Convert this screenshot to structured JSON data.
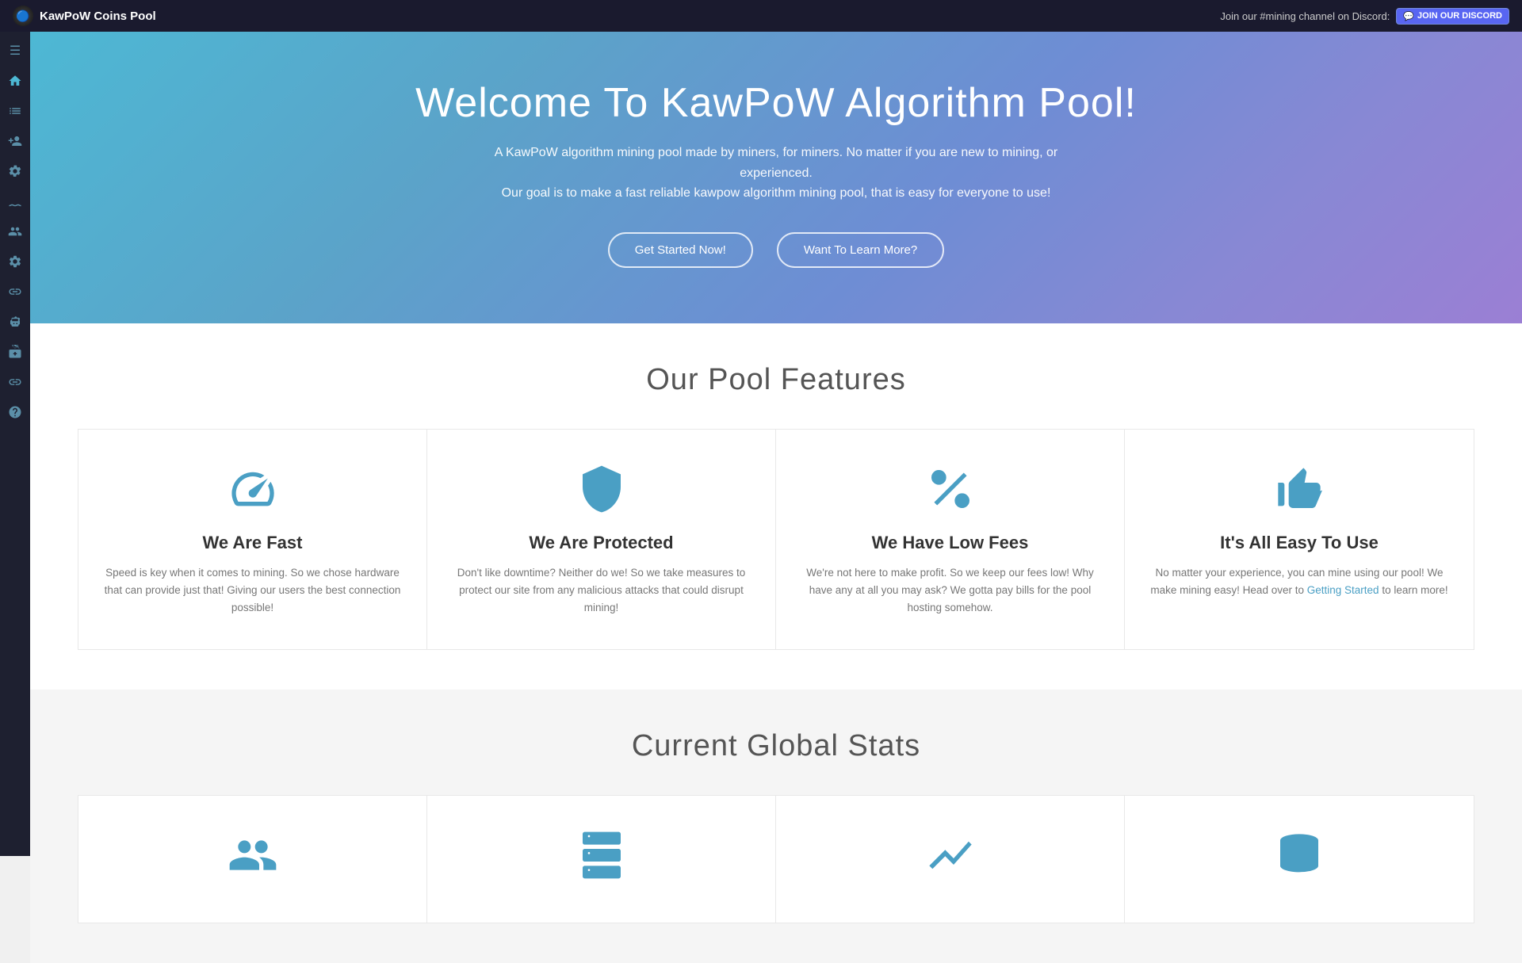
{
  "topbar": {
    "logo_icon": "🔵",
    "site_title": "KawPoW Coins Pool",
    "discord_text": "Join our #mining channel on Discord:",
    "discord_badge": "JOIN OUR DISCORD"
  },
  "sidebar": {
    "items": [
      {
        "icon": "☰",
        "name": "menu"
      },
      {
        "icon": "🏠",
        "name": "home"
      },
      {
        "icon": "📋",
        "name": "list"
      },
      {
        "icon": "👤+",
        "name": "add-user"
      },
      {
        "icon": "⚙",
        "name": "settings"
      },
      {
        "icon": "〰",
        "name": "waves"
      },
      {
        "icon": "👥",
        "name": "users"
      },
      {
        "icon": "🏗",
        "name": "build"
      },
      {
        "icon": "🔗",
        "name": "chain"
      },
      {
        "icon": "🤖",
        "name": "robot"
      },
      {
        "icon": "📦",
        "name": "box"
      },
      {
        "icon": "🔗",
        "name": "link"
      },
      {
        "icon": "❓",
        "name": "help"
      }
    ]
  },
  "hero": {
    "title": "Welcome To KawPoW Algorithm Pool!",
    "description_line1": "A KawPoW algorithm mining pool made by miners, for miners. No matter if you are new to mining, or experienced.",
    "description_line2": "Our goal is to make a fast reliable kawpow algorithm mining pool, that is easy for everyone to use!",
    "btn_start": "Get Started Now!",
    "btn_learn": "Want To Learn More?"
  },
  "features": {
    "section_title": "Our Pool Features",
    "cards": [
      {
        "icon": "speedometer",
        "title": "We Are Fast",
        "desc": "Speed is key when it comes to mining. So we chose hardware that can provide just that! Giving our users the best connection possible!"
      },
      {
        "icon": "shield",
        "title": "We Are Protected",
        "desc": "Don't like downtime? Neither do we! So we take measures to protect our site from any malicious attacks that could disrupt mining!"
      },
      {
        "icon": "percent",
        "title": "We Have Low Fees",
        "desc": "We're not here to make profit. So we keep our fees low! Why have any at all you may ask? We gotta pay bills for the pool hosting somehow."
      },
      {
        "icon": "thumbsup",
        "title": "It's All Easy To Use",
        "desc": "No matter your experience, you can mine using our pool! We make mining easy! Head over to",
        "link_text": "Getting Started",
        "desc2": "to learn more!"
      }
    ]
  },
  "stats": {
    "section_title": "Current Global Stats",
    "cards": [
      {
        "icon": "users",
        "title": ""
      },
      {
        "icon": "servers",
        "title": ""
      },
      {
        "icon": "chart",
        "title": ""
      },
      {
        "icon": "database",
        "title": ""
      }
    ]
  },
  "colors": {
    "accent": "#4a9fc4",
    "sidebar_bg": "#1e2030",
    "topbar_bg": "#1a1a2e",
    "hero_start": "#4db8d4",
    "hero_end": "#9b7fd4"
  }
}
